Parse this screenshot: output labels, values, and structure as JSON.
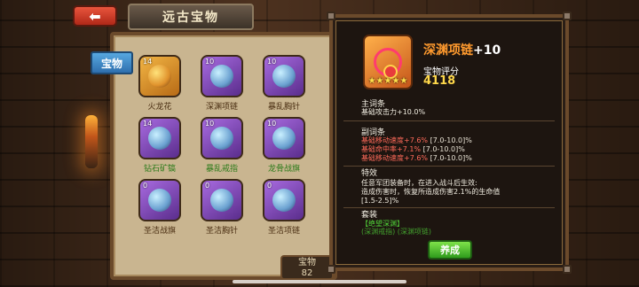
{
  "header": {
    "back_icon": "back-arrow-icon",
    "title": "远古宝物"
  },
  "sidebar": {
    "tab_label": "宝物"
  },
  "treasure_grid": [
    {
      "level": "14",
      "name": "火龙花",
      "stars": "★★★★★",
      "style": "gold",
      "name_color": "default"
    },
    {
      "level": "10",
      "name": "深渊项链",
      "stars": "★★★★★",
      "style": "purple",
      "name_color": "default"
    },
    {
      "level": "10",
      "name": "暴乱胸针",
      "stars": "★★★★★",
      "style": "purple",
      "name_color": "default"
    },
    {
      "level": "14",
      "name": "钻石矿镐",
      "stars": "★★★★★",
      "style": "purple",
      "name_color": "green"
    },
    {
      "level": "10",
      "name": "暴乱戒指",
      "stars": "★★★★★",
      "style": "purple",
      "name_color": "green"
    },
    {
      "level": "10",
      "name": "龙骨战旗",
      "stars": "★★★★★",
      "style": "purple",
      "name_color": "green"
    },
    {
      "level": "0",
      "name": "圣洁战旗",
      "stars": "★★★★★",
      "style": "purple",
      "name_color": "default"
    },
    {
      "level": "0",
      "name": "圣洁胸针",
      "stars": "★★★★★",
      "style": "purple",
      "name_color": "default"
    },
    {
      "level": "0",
      "name": "圣洁项链",
      "stars": "★★★★★",
      "style": "purple",
      "name_color": "default"
    }
  ],
  "bottom_counter": {
    "label": "宝物",
    "value": "82"
  },
  "detail": {
    "item_name": "深渊项链",
    "item_plus": "+10",
    "item_stars": "★★★★★",
    "score_label": "宝物评分",
    "score_value": "4118",
    "main_title": "主词条",
    "main_line": "基础攻击力+10.0%",
    "sub_title": "副词条",
    "sub_lines": [
      {
        "text": "基础移动速度+7.6%",
        "range": "[7.0-10.0]%"
      },
      {
        "text": "基础命中率+7.1%",
        "range": "[7.0-10.0]%"
      },
      {
        "text": "基础移动速度+7.6%",
        "range": "[7.0-10.0]%"
      }
    ],
    "special_title": "特效",
    "special_line1": "任意军团装备时，在进入战斗后生效:",
    "special_line2": "造成伤害时，恢复所造成伤害2.1%的生命值",
    "special_line3": "[1.5-2.5]%",
    "set_title": "套装",
    "set_name": "【绝望深渊】",
    "set_members": "(深渊戒指) (深渊项链)",
    "cultivate_label": "养成"
  },
  "colors": {
    "accent_orange": "#ff9a2e",
    "score_yellow": "#ffd84a",
    "substat_red": "#ff6a5a",
    "set_green": "#52d93a",
    "button_green": "#3fb824"
  }
}
